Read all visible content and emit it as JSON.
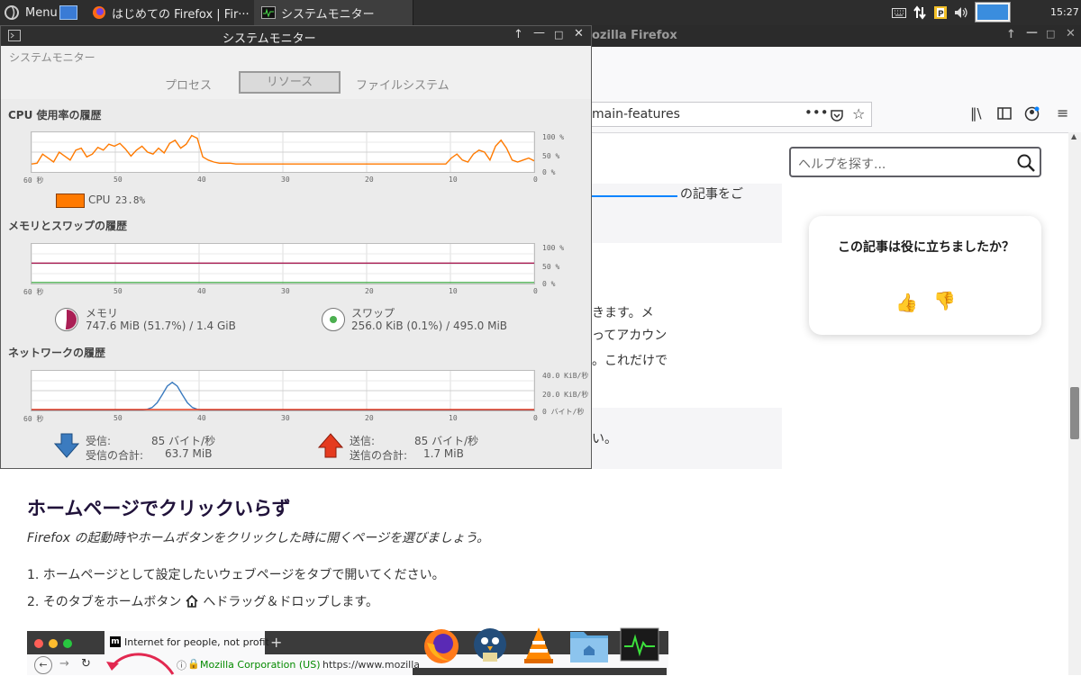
{
  "top_panel": {
    "menu_label": "Menu",
    "tasks": [
      {
        "label": "はじめての Firefox | Fir···"
      },
      {
        "label": "システムモニター"
      }
    ],
    "clock": "15:27"
  },
  "firefox": {
    "window_title": "ozilla Firefox",
    "url_fragment": "main-features",
    "search_placeholder": "ヘルプを探す...",
    "feedback": {
      "question": "この記事は役に立ちましたか？",
      "yes_icon": "thumbs-up",
      "no_icon": "thumbs-down"
    },
    "partial_lines": [
      "きます。メ",
      "ってアカウン",
      "。これだけで",
      "い。"
    ],
    "partial_link_top": "の記事をご",
    "heading": "ホームページでクリックいらず",
    "intro": "Firefox の起動時やホームボタンをクリックした時に開くページを選びましょう。",
    "steps": [
      "1. ホームページとして設定したいウェブページをタブで開いてください。",
      "2. そのタブをホームボタン",
      "へドラッグ＆ドロップします。"
    ],
    "screenshot_tab": "Internet for people, not profit ···",
    "screenshot_identity": "Mozilla Corporation (US)",
    "screenshot_url": "https://www.mozilla"
  },
  "system_monitor": {
    "title": "システムモニター",
    "header_label": "システムモニター",
    "tabs": [
      "プロセス",
      "リソース",
      "ファイルシステム"
    ],
    "active_tab": "リソース",
    "cpu": {
      "heading": "CPU 使用率の履歴",
      "legend": "CPU",
      "value": "23.8%",
      "color": "#ff7a00",
      "y_ticks": [
        "100 %",
        "50 %",
        "0 %"
      ],
      "x_ticks": [
        "60 秒",
        "50",
        "40",
        "30",
        "20",
        "10",
        "0"
      ],
      "series_pct": [
        20,
        22,
        45,
        35,
        25,
        50,
        40,
        30,
        55,
        60,
        38,
        45,
        62,
        55,
        70,
        65,
        72,
        58,
        40,
        55,
        65,
        50,
        45,
        60,
        48,
        72,
        80,
        60,
        70,
        92,
        85,
        38,
        30,
        25,
        22,
        22,
        22,
        20,
        20,
        20,
        20,
        20,
        20,
        20,
        20,
        20,
        20,
        20,
        20,
        20,
        20,
        20,
        20,
        20,
        20,
        20,
        20,
        20,
        20,
        20,
        20,
        20,
        20,
        20,
        20,
        20,
        20,
        20,
        20,
        20,
        20,
        20,
        20,
        20,
        20,
        20,
        35,
        45,
        30,
        25,
        45,
        55,
        50,
        30,
        65,
        80,
        60,
        30,
        25,
        30,
        35,
        28
      ]
    },
    "memory": {
      "heading": "メモリとスワップの履歴",
      "y_ticks": [
        "100 %",
        "50 %",
        "0 %"
      ],
      "x_ticks": [
        "60 秒",
        "50",
        "40",
        "30",
        "20",
        "10",
        "0"
      ],
      "memory_label": "メモリ",
      "memory_value": "747.6 MiB (51.7%) / 1.4 GiB",
      "memory_pct": 51.7,
      "memory_color": "#aa1f55",
      "swap_label": "スワップ",
      "swap_value": "256.0 KiB (0.1%) / 495.0 MiB",
      "swap_pct": 0.1,
      "swap_color": "#4caf50"
    },
    "network": {
      "heading": "ネットワークの履歴",
      "y_ticks": [
        "40.0 KiB/秒",
        "20.0 KiB/秒",
        "0 バイト/秒"
      ],
      "x_ticks": [
        "60 秒",
        "50",
        "40",
        "30",
        "20",
        "10",
        "0"
      ],
      "recv_label": "受信:",
      "recv_rate": "85 バイト/秒",
      "recv_total_label": "受信の合計:",
      "recv_total": "63.7 MiB",
      "send_label": "送信:",
      "send_rate": "85 バイト/秒",
      "send_total_label": "送信の合計:",
      "send_total": "1.7 MiB",
      "recv_color": "#3b7bbf",
      "send_color": "#e53b1f"
    }
  }
}
